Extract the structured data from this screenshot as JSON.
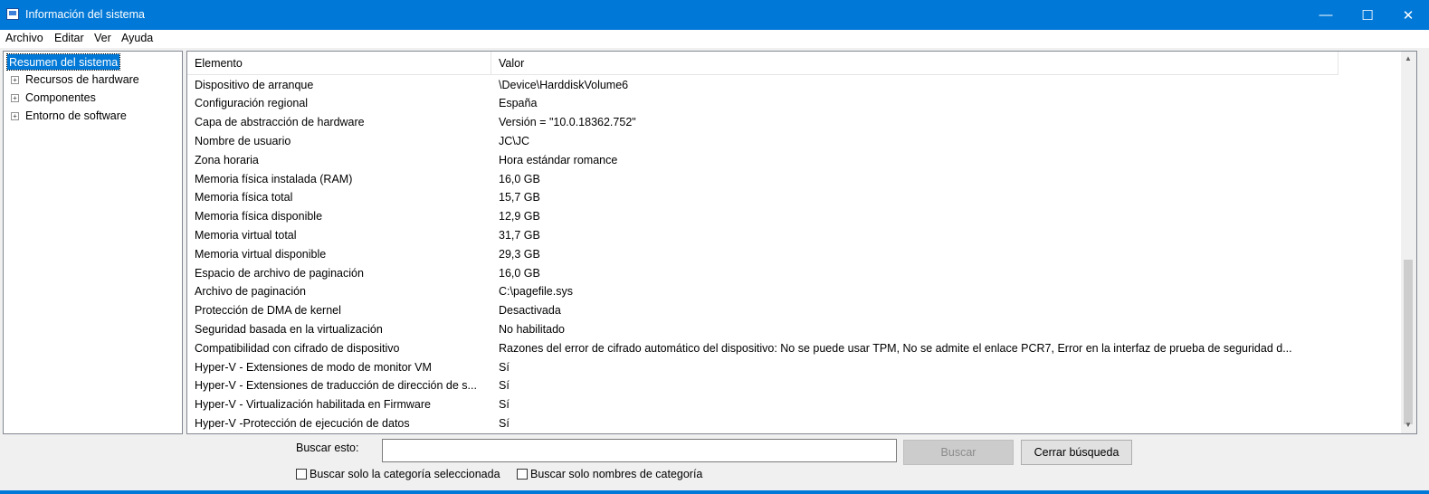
{
  "window": {
    "title": "Información del sistema",
    "minimize_glyph": "—",
    "maximize_glyph": "☐",
    "close_glyph": "✕"
  },
  "menu": [
    "Archivo",
    "Editar",
    "Ver",
    "Ayuda"
  ],
  "tree": {
    "root": "Resumen del sistema",
    "children": [
      "Recursos de hardware",
      "Componentes",
      "Entorno de software"
    ],
    "expander_glyph": "+"
  },
  "table": {
    "columns": [
      "Elemento",
      "Valor"
    ],
    "rows": [
      [
        "Dispositivo de arranque",
        "\\Device\\HarddiskVolume6"
      ],
      [
        "Configuración regional",
        "España"
      ],
      [
        "Capa de abstracción de hardware",
        "Versión = \"10.0.18362.752\""
      ],
      [
        "Nombre de usuario",
        "JC\\JC"
      ],
      [
        "Zona horaria",
        "Hora estándar romance"
      ],
      [
        "Memoria física instalada (RAM)",
        "16,0 GB"
      ],
      [
        "Memoria física total",
        "15,7 GB"
      ],
      [
        "Memoria física disponible",
        "12,9 GB"
      ],
      [
        "Memoria virtual total",
        "31,7 GB"
      ],
      [
        "Memoria virtual disponible",
        "29,3 GB"
      ],
      [
        "Espacio de archivo de paginación",
        "16,0 GB"
      ],
      [
        "Archivo de paginación",
        "C:\\pagefile.sys"
      ],
      [
        "Protección de DMA de kernel",
        "Desactivada"
      ],
      [
        "Seguridad basada en la virtualización",
        "No habilitado"
      ],
      [
        "Compatibilidad con cifrado de dispositivo",
        "Razones del error de cifrado automático del dispositivo: No se puede usar TPM, No se admite el enlace PCR7, Error en la interfaz de prueba de seguridad d..."
      ],
      [
        "Hyper-V - Extensiones de modo de monitor VM",
        "Sí"
      ],
      [
        "Hyper-V - Extensiones de traducción de dirección de s...",
        "Sí"
      ],
      [
        "Hyper-V - Virtualización habilitada en Firmware",
        "Sí"
      ],
      [
        "Hyper-V -Protección de ejecución de datos",
        "Sí"
      ]
    ]
  },
  "scrollbar": {
    "up_glyph": "▲",
    "down_glyph": "▼"
  },
  "search": {
    "label": "Buscar esto:",
    "value": "",
    "search_button": "Buscar",
    "close_button": "Cerrar búsqueda",
    "check_selected": "Buscar solo la categoría seleccionada",
    "check_names": "Buscar solo nombres de categoría"
  }
}
